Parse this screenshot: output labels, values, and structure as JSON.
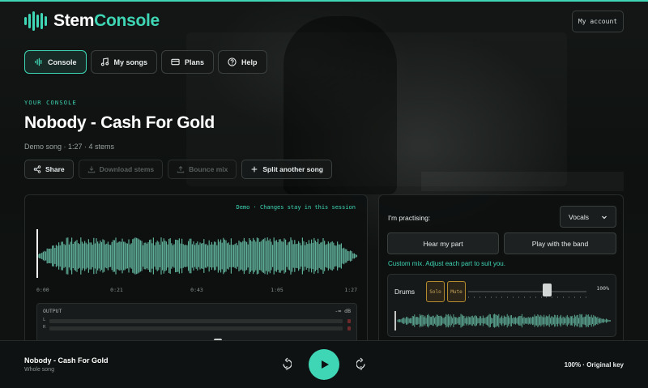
{
  "brand": {
    "name_a": "Stem",
    "name_b": "Console",
    "accent": "#3ed6b4"
  },
  "header": {
    "account_label": "My account"
  },
  "nav": {
    "items": [
      {
        "label": "Console",
        "icon": "waveform-icon",
        "active": true
      },
      {
        "label": "My songs",
        "icon": "music-note-icon",
        "active": false
      },
      {
        "label": "Plans",
        "icon": "credit-card-icon",
        "active": false
      },
      {
        "label": "Help",
        "icon": "help-circle-icon",
        "active": false
      }
    ]
  },
  "song": {
    "eyebrow": "YOUR CONSOLE",
    "title": "Nobody - Cash For Gold",
    "meta": "Demo song · 1:27 · 4 stems"
  },
  "actions": {
    "share": "Share",
    "download": "Download stems",
    "bounce": "Bounce mix",
    "split": "Split another song"
  },
  "waveform": {
    "note": "Demo · Changes stay in this session",
    "progress": 0,
    "times": [
      "0:00",
      "0:21",
      "0:43",
      "1:05",
      "1:27"
    ]
  },
  "output": {
    "label": "OUTPUT",
    "db": "-∞ dB",
    "left": "L",
    "right": "R"
  },
  "practice": {
    "label": "I'm practising:",
    "part": "Vocals",
    "hear_part": "Hear my part",
    "play_band": "Play with the band",
    "custom_mix": "Custom mix. Adjust each part to suit you."
  },
  "stems": [
    {
      "name": "Drums",
      "solo": "Solo",
      "mute": "Mute",
      "volume_label": "100%",
      "volume": 1.0
    }
  ],
  "player": {
    "title": "Nobody - Cash For Gold",
    "subtitle": "Whole song",
    "skip_back": "5",
    "skip_fwd": "5",
    "status": "100% · Original key"
  }
}
